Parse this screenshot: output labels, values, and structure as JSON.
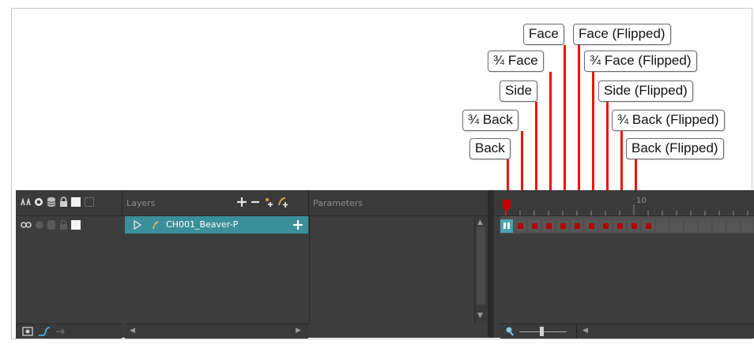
{
  "callouts": {
    "face": "Face",
    "face_flipped": "Face (Flipped)",
    "three_quarter_face": "¾ Face",
    "three_quarter_face_flipped": "¾ Face (Flipped)",
    "side": "Side",
    "side_flipped": "Side (Flipped)",
    "three_quarter_back": "¾ Back",
    "three_quarter_back_flipped": "¾ Back (Flipped)",
    "back": "Back",
    "back_flipped": "Back (Flipped)"
  },
  "layers_panel": {
    "label": "Layers",
    "params_label": "Parameters",
    "layer_name": "CH001_Beaver-P"
  },
  "timeline": {
    "frame_marker": "10"
  },
  "colors": {
    "leader": "#ee1111",
    "keyframe": "#b20000",
    "selected_layer": "#3a8f9a"
  }
}
